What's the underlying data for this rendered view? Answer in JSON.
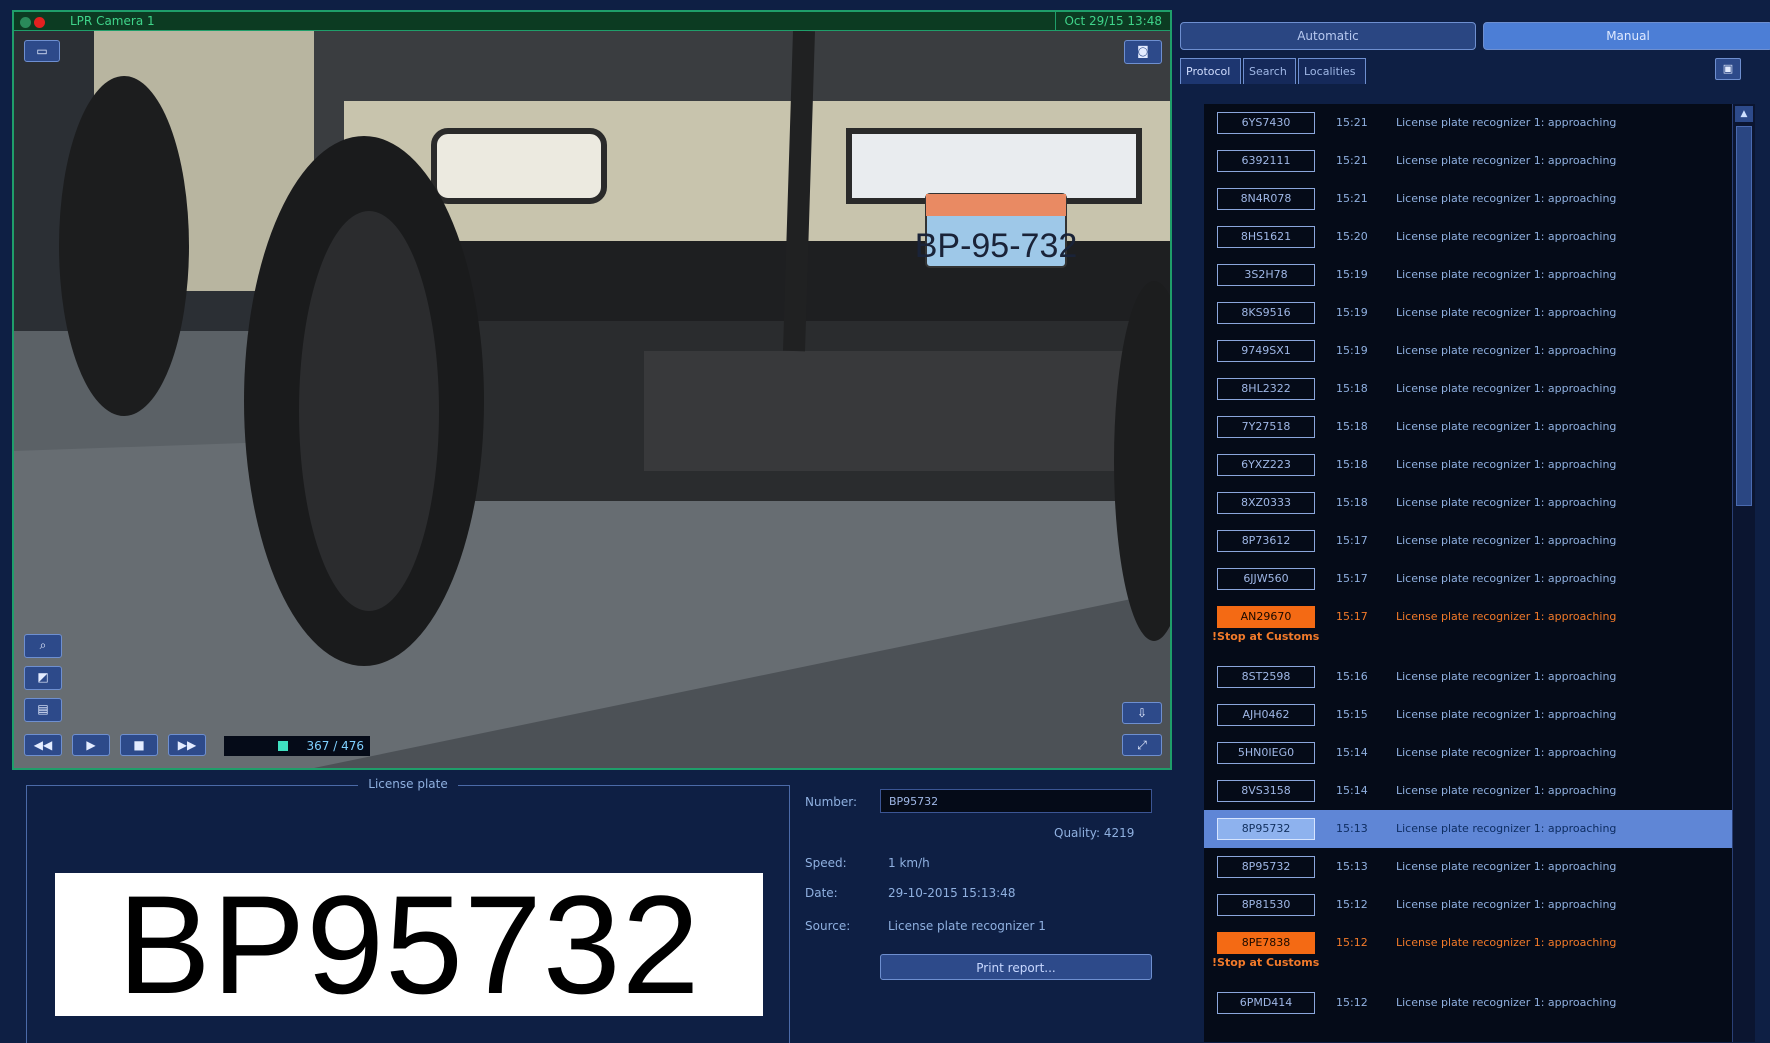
{
  "video": {
    "title": "LPR Camera 1",
    "timestamp": "Oct 29/15 13:48",
    "plate_in_scene": "BP-95-732",
    "counter": "367 / 476",
    "controls": {
      "rewind": "◀◀",
      "play": "▶",
      "stop": "■",
      "forward": "▶▶"
    }
  },
  "plate_panel": {
    "legend": "License plate",
    "plate_text": "BP95732",
    "number_label": "Number:",
    "number_value": "BP95732",
    "quality": "Quality: 4219",
    "speed_label": "Speed:",
    "speed_value": "1 km/h",
    "date_label": "Date:",
    "date_value": "29-10-2015 15:13:48",
    "source_label": "Source:",
    "source_value": "License plate recognizer 1",
    "print_button": "Print report..."
  },
  "right": {
    "mode_buttons": {
      "automatic": "Automatic",
      "manual": "Manual"
    },
    "tabs": {
      "protocol": "Protocol",
      "search": "Search",
      "localities": "Localities"
    },
    "rows": [
      {
        "plate": "6YS7430",
        "time": "15:21",
        "event": "License plate recognizer 1: approaching"
      },
      {
        "plate": "6392111",
        "time": "15:21",
        "event": "License plate recognizer 1: approaching"
      },
      {
        "plate": "8N4R078",
        "time": "15:21",
        "event": "License plate recognizer 1: approaching"
      },
      {
        "plate": "8HS1621",
        "time": "15:20",
        "event": "License plate recognizer 1: approaching"
      },
      {
        "plate": "3S2H78",
        "time": "15:19",
        "event": "License plate recognizer 1: approaching"
      },
      {
        "plate": "8KS9516",
        "time": "15:19",
        "event": "License plate recognizer 1: approaching"
      },
      {
        "plate": "9749SX1",
        "time": "15:19",
        "event": "License plate recognizer 1: approaching"
      },
      {
        "plate": "8HL2322",
        "time": "15:18",
        "event": "License plate recognizer 1: approaching"
      },
      {
        "plate": "7Y27518",
        "time": "15:18",
        "event": "License plate recognizer 1: approaching"
      },
      {
        "plate": "6YXZ223",
        "time": "15:18",
        "event": "License plate recognizer 1: approaching"
      },
      {
        "plate": "8XZ0333",
        "time": "15:18",
        "event": "License plate recognizer 1: approaching"
      },
      {
        "plate": "8P73612",
        "time": "15:17",
        "event": "License plate recognizer 1: approaching"
      },
      {
        "plate": "6JJW560",
        "time": "15:17",
        "event": "License plate recognizer 1: approaching"
      },
      {
        "plate": "AN29670",
        "time": "15:17",
        "event": "License plate recognizer 1: approaching",
        "note": "!Stop at Customs"
      },
      {
        "plate": "8ST2598",
        "time": "15:16",
        "event": "License plate recognizer 1: approaching"
      },
      {
        "plate": "AJH0462",
        "time": "15:15",
        "event": "License plate recognizer 1: approaching"
      },
      {
        "plate": "5HN0IEG0",
        "time": "15:14",
        "event": "License plate recognizer 1: approaching"
      },
      {
        "plate": "8VS3158",
        "time": "15:14",
        "event": "License plate recognizer 1: approaching"
      },
      {
        "plate": "8P95732",
        "time": "15:13",
        "event": "License plate recognizer 1: approaching"
      },
      {
        "plate": "8P95732",
        "time": "15:13",
        "event": "License plate recognizer 1: approaching"
      },
      {
        "plate": "8P81530",
        "time": "15:12",
        "event": "License plate recognizer 1: approaching"
      },
      {
        "plate": "8PE7838",
        "time": "15:12",
        "event": "License plate recognizer 1: approaching",
        "note": "!Stop at Customs"
      },
      {
        "plate": "6PMD414",
        "time": "15:12",
        "event": "License plate recognizer 1: approaching"
      }
    ]
  },
  "colors": {
    "background": "#0e1f44",
    "video_border": "#1f9e6a",
    "alert_orange": "#f46a14",
    "selected_row": "#5f86d6"
  },
  "icons": [
    "camera-icon",
    "record-icon",
    "snapshot-icon",
    "zoom-icon",
    "image-icon",
    "export-icon",
    "list-view-icon",
    "scroll-up-icon"
  ]
}
